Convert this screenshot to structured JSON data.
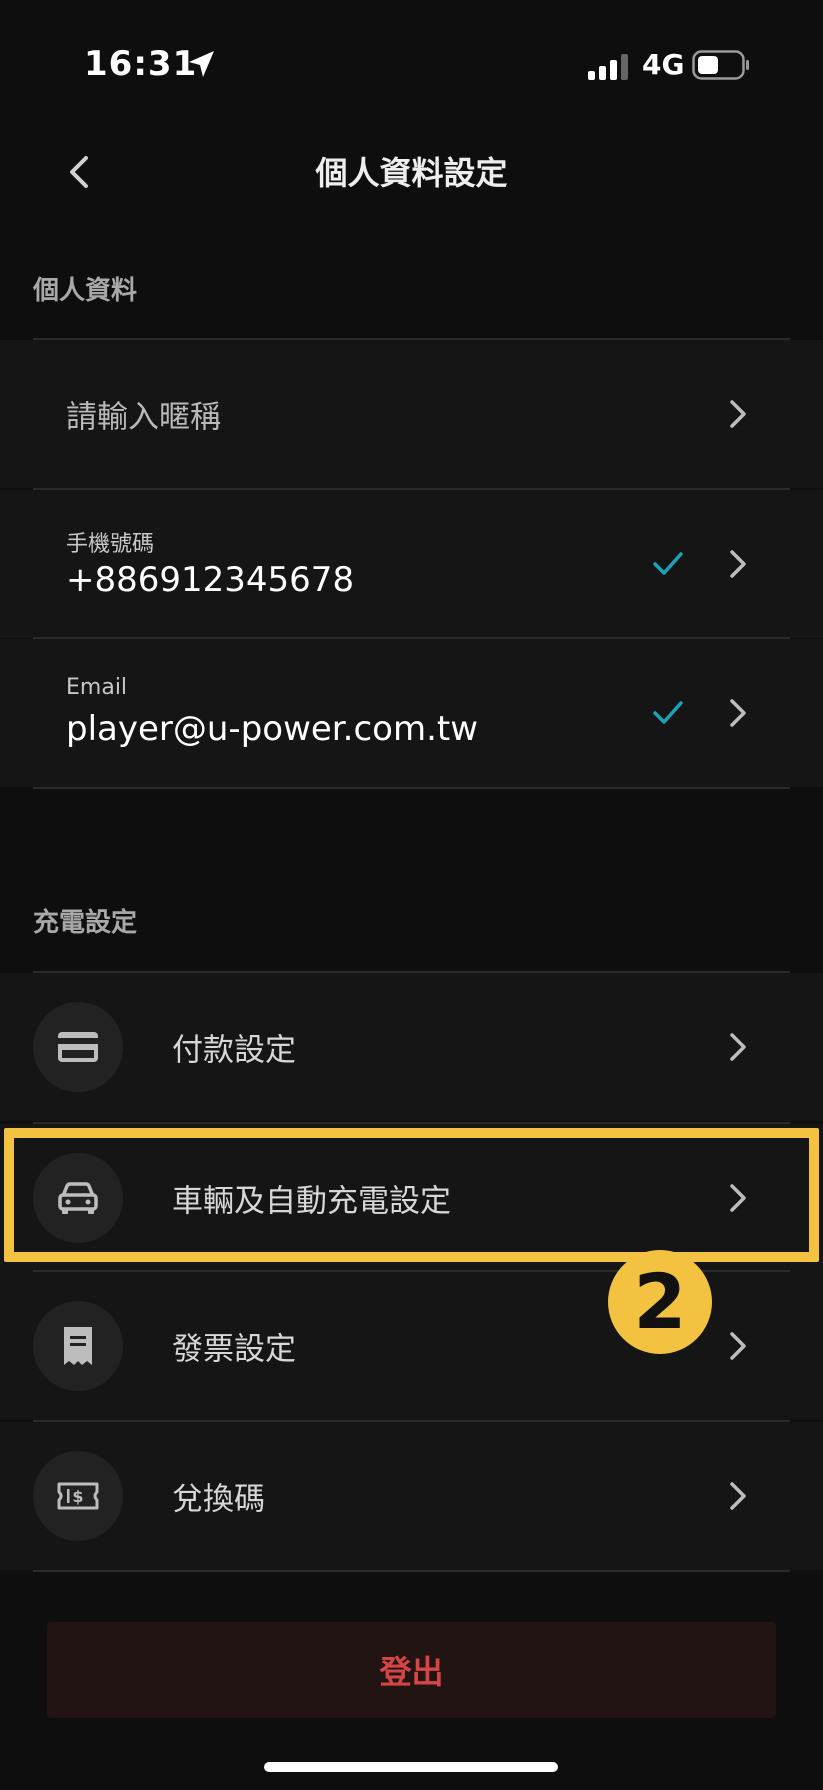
{
  "status_bar": {
    "time": "16:31",
    "network": "4G"
  },
  "nav": {
    "title": "個人資料設定"
  },
  "personal_section": {
    "title": "個人資料",
    "nickname_placeholder": "請輸入暱稱",
    "phone": {
      "label": "手機號碼",
      "value": "+886912345678"
    },
    "email": {
      "label": "Email",
      "value": "player@u-power.com.tw"
    }
  },
  "charging_section": {
    "title": "充電設定",
    "items": [
      {
        "label": "付款設定",
        "icon": "credit-card-icon"
      },
      {
        "label": "車輛及自動充電設定",
        "icon": "car-icon"
      },
      {
        "label": "發票設定",
        "icon": "receipt-icon"
      },
      {
        "label": "兌換碼",
        "icon": "voucher-icon"
      }
    ]
  },
  "annotation": {
    "step_number": "2"
  },
  "logout": {
    "label": "登出"
  },
  "colors": {
    "background": "#0e0e0e",
    "row_background": "#151515",
    "accent_check": "#1aa3b8",
    "highlight": "#f3c241",
    "logout_text": "#d64545",
    "logout_background": "#231414"
  }
}
